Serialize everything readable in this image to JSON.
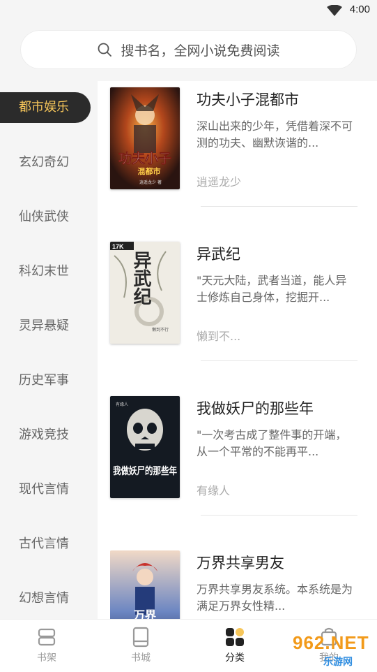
{
  "status": {
    "time": "4:00"
  },
  "search": {
    "placeholder": "搜书名，全网小说免费阅读"
  },
  "sidebar": {
    "items": [
      {
        "label": "都市娱乐"
      },
      {
        "label": "玄幻奇幻"
      },
      {
        "label": "仙侠武侠"
      },
      {
        "label": "科幻末世"
      },
      {
        "label": "灵异悬疑"
      },
      {
        "label": "历史军事"
      },
      {
        "label": "游戏竞技"
      },
      {
        "label": "现代言情"
      },
      {
        "label": "古代言情"
      },
      {
        "label": "幻想言情"
      }
    ]
  },
  "books": [
    {
      "title": "功夫小子混都市",
      "desc": "深山出来的少年，凭借着深不可测的功夫、幽默诙谐的...",
      "author": "逍遥龙少",
      "cover_text": "功夫小子",
      "cover_sub": "混都市",
      "cover_author": "逍遥龙少 著"
    },
    {
      "title": "异武纪",
      "desc": "\"天元大陆，武者当道，能人异士修炼自己身体，挖掘开...",
      "author": "懒到不...",
      "cover_text": "异武纪",
      "cover_badge": "17K",
      "cover_author": "懒到不行"
    },
    {
      "title": "我做妖尸的那些年",
      "desc": "\"一次考古成了整件事的开端，从一个平常的不能再平...",
      "author": "有缘人",
      "cover_text": "我做妖尸的那些年",
      "cover_author": "有缘人"
    },
    {
      "title": "万界共享男友",
      "desc": "万界共享男友系统。本系统是为满足万界女性精...",
      "author": "",
      "cover_text": "万界"
    }
  ],
  "nav": {
    "items": [
      {
        "label": "书架"
      },
      {
        "label": "书城"
      },
      {
        "label": "分类"
      },
      {
        "label": "我的"
      }
    ]
  },
  "watermark": {
    "big": "962.NET",
    "small": "乐游网"
  },
  "colors": {
    "accent": "#f6c65a",
    "active_bg": "#2b2b2b",
    "panel": "#f5f5f5"
  }
}
